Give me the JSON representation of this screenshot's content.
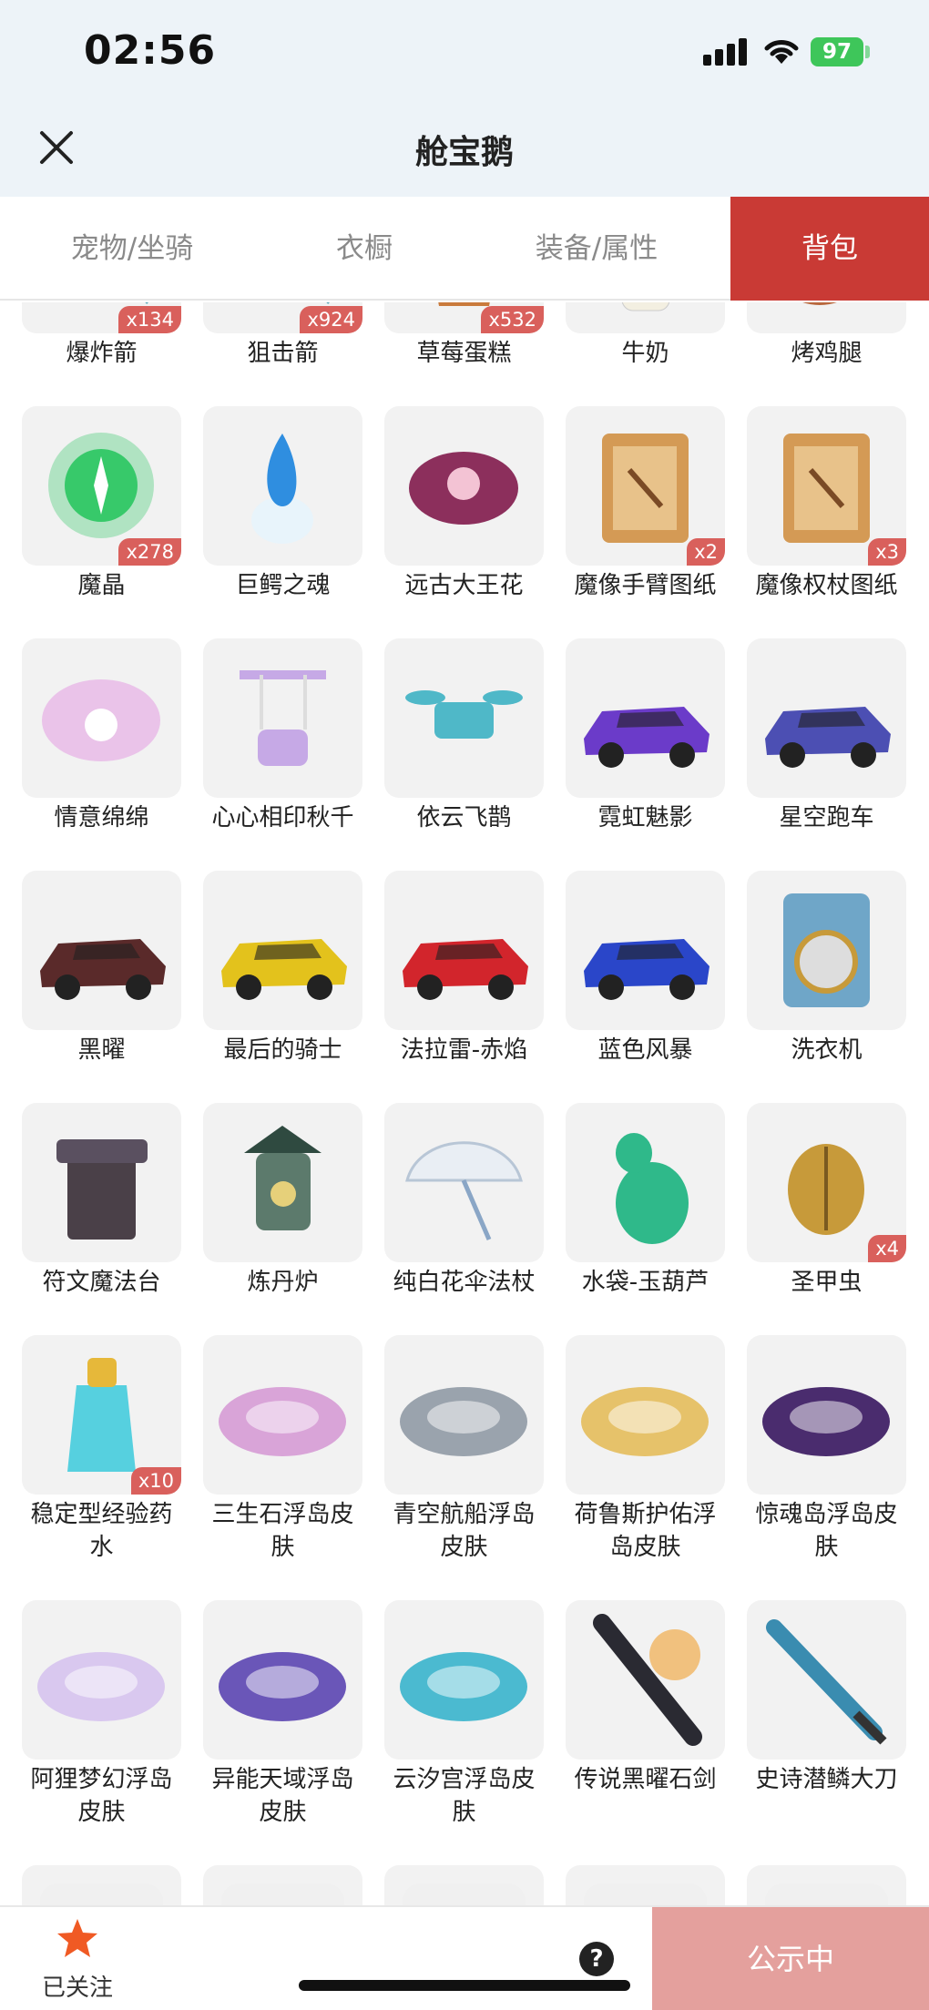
{
  "status_bar": {
    "time": "02:56",
    "battery": "97"
  },
  "header": {
    "title": "舱宝鹅"
  },
  "tabs": [
    {
      "label": "宠物/坐骑",
      "active": false
    },
    {
      "label": "衣橱",
      "active": false
    },
    {
      "label": "装备/属性",
      "active": false
    },
    {
      "label": "背包",
      "active": true
    }
  ],
  "items": [
    {
      "name": "",
      "qty": "",
      "icon": "partial-item-icon",
      "color": "#d8d8d8"
    },
    {
      "name": "",
      "qty": "",
      "icon": "partial-item-icon",
      "color": "#d8d8d8"
    },
    {
      "name": "",
      "qty": "",
      "icon": "partial-item-icon",
      "color": "#d8d8d8"
    },
    {
      "name": "",
      "qty": "",
      "icon": "partial-item-icon",
      "color": "#d8d8d8"
    },
    {
      "name": "",
      "qty": "",
      "icon": "partial-item-icon",
      "color": "#d8d8d8"
    },
    {
      "name": "爆炸箭",
      "qty": "x134",
      "icon": "arrow-icon",
      "color": "#58a6b8"
    },
    {
      "name": "狙击箭",
      "qty": "x924",
      "icon": "arrow-icon",
      "color": "#58a6b8"
    },
    {
      "name": "草莓蛋糕",
      "qty": "x532",
      "icon": "cake-icon",
      "color": "#c97a3c"
    },
    {
      "name": "牛奶",
      "qty": "",
      "icon": "milk-icon",
      "color": "#f3efe1"
    },
    {
      "name": "烤鸡腿",
      "qty": "",
      "icon": "drumstick-icon",
      "color": "#b8673d"
    },
    {
      "name": "魔晶",
      "qty": "x278",
      "icon": "crystal-icon",
      "color": "#37c96a"
    },
    {
      "name": "巨鳄之魂",
      "qty": "",
      "icon": "soul-icon",
      "color": "#2f8ee0"
    },
    {
      "name": "远古大王花",
      "qty": "",
      "icon": "flower-icon",
      "color": "#8c2f5c"
    },
    {
      "name": "魔像手臂图纸",
      "qty": "x2",
      "icon": "scroll-icon",
      "color": "#d49a55"
    },
    {
      "name": "魔像权杖图纸",
      "qty": "x3",
      "icon": "scroll-icon",
      "color": "#d49a55"
    },
    {
      "name": "情意绵绵",
      "qty": "",
      "icon": "wings-icon",
      "color": "#e7b6e6"
    },
    {
      "name": "心心相印秋千",
      "qty": "",
      "icon": "swing-icon",
      "color": "#c6a9e6"
    },
    {
      "name": "依云飞鹊",
      "qty": "",
      "icon": "drone-icon",
      "color": "#4fb8c8"
    },
    {
      "name": "霓虹魅影",
      "qty": "",
      "icon": "car-icon",
      "color": "#6b3bc9"
    },
    {
      "name": "星空跑车",
      "qty": "",
      "icon": "car-icon",
      "color": "#4c4fb3"
    },
    {
      "name": "黑曜",
      "qty": "",
      "icon": "car-icon",
      "color": "#5a2a2a"
    },
    {
      "name": "最后的骑士",
      "qty": "",
      "icon": "car-icon",
      "color": "#e3c21c"
    },
    {
      "name": "法拉雷-赤焰",
      "qty": "",
      "icon": "car-icon",
      "color": "#d2252c"
    },
    {
      "name": "蓝色风暴",
      "qty": "",
      "icon": "car-icon",
      "color": "#2a46c9"
    },
    {
      "name": "洗衣机",
      "qty": "",
      "icon": "washer-icon",
      "color": "#6fa6c8"
    },
    {
      "name": "符文魔法台",
      "qty": "",
      "icon": "altar-icon",
      "color": "#4a4048"
    },
    {
      "name": "炼丹炉",
      "qty": "",
      "icon": "furnace-icon",
      "color": "#5c7a6c"
    },
    {
      "name": "纯白花伞法杖",
      "qty": "",
      "icon": "umbrella-icon",
      "color": "#e9eef4"
    },
    {
      "name": "水袋-玉葫芦",
      "qty": "",
      "icon": "gourd-icon",
      "color": "#2fb98a"
    },
    {
      "name": "圣甲虫",
      "qty": "x4",
      "icon": "beetle-icon",
      "color": "#c79a3a"
    },
    {
      "name": "稳定型经验药水",
      "qty": "x10",
      "icon": "potion-icon",
      "color": "#56d0df"
    },
    {
      "name": "三生石浮岛皮肤",
      "qty": "",
      "icon": "island-icon",
      "color": "#d9a4d8"
    },
    {
      "name": "青空航船浮岛皮肤",
      "qty": "",
      "icon": "island-icon",
      "color": "#9aa3ad"
    },
    {
      "name": "荷鲁斯护佑浮岛皮肤",
      "qty": "",
      "icon": "island-icon",
      "color": "#e6c26a"
    },
    {
      "name": "惊魂岛浮岛皮肤",
      "qty": "",
      "icon": "island-icon",
      "color": "#4a2c6e"
    },
    {
      "name": "阿狸梦幻浮岛皮肤",
      "qty": "",
      "icon": "island-icon",
      "color": "#d9c8ef"
    },
    {
      "name": "异能天域浮岛皮肤",
      "qty": "",
      "icon": "island-icon",
      "color": "#6a56b8"
    },
    {
      "name": "云汐宫浮岛皮肤",
      "qty": "",
      "icon": "island-icon",
      "color": "#4bbad0"
    },
    {
      "name": "传说黑曜石剑",
      "qty": "",
      "icon": "sword-icon",
      "color": "#2a2a32"
    },
    {
      "name": "史诗潜鳞大刀",
      "qty": "",
      "icon": "blade-icon",
      "color": "#3a8cb0"
    },
    {
      "name": "",
      "qty": "",
      "icon": "partial-item-icon",
      "color": "#eeeeee"
    },
    {
      "name": "",
      "qty": "",
      "icon": "partial-item-icon",
      "color": "#eeeeee"
    },
    {
      "name": "",
      "qty": "",
      "icon": "partial-item-icon",
      "color": "#eeeeee"
    },
    {
      "name": "",
      "qty": "",
      "icon": "partial-item-icon",
      "color": "#eeeeee"
    },
    {
      "name": "",
      "qty": "",
      "icon": "partial-item-icon",
      "color": "#eeeeee"
    }
  ],
  "bottom_bar": {
    "follow_label": "已关注",
    "help_label": "?",
    "publish_label": "公示中"
  },
  "colors": {
    "accent": "#c93a35",
    "publish": "#e4a09d",
    "qty_badge": "#d9605c",
    "star": "#f05a24"
  }
}
